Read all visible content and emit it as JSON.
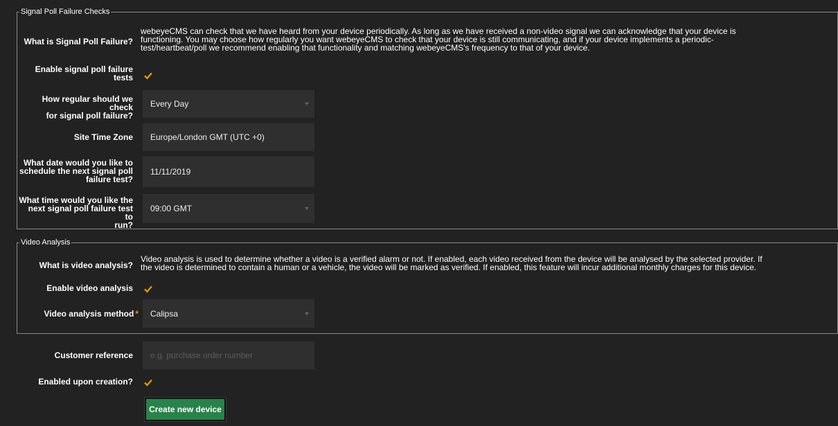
{
  "signal_poll": {
    "legend": "Signal Poll Failure Checks",
    "what_label": "What is Signal Poll Failure?",
    "what_desc_lines": [
      "webeyeCMS can check that we have heard from your device periodically. As long as we have received a non-video signal we can acknowledge that your device is",
      "functioning. You may choose how regularly you want webeyeCMS to check that your device is still communicating, and if your device implements a periodic-",
      "test/heartbeat/poll we recommend enabling that functionality and matching webeyeCMS's frequency to that of your device."
    ],
    "enable_label_lines": [
      "Enable signal poll failure",
      "tests"
    ],
    "enable_checked": true,
    "frequency_label_lines": [
      "How regular should we check",
      "for signal poll failure?"
    ],
    "frequency_value": "Every Day",
    "timezone_label": "Site Time Zone",
    "timezone_value": "Europe/London GMT (UTC +0)",
    "date_label_lines": [
      "What date would you like to",
      "schedule the next signal poll",
      "failure test?"
    ],
    "date_value": "11/11/2019",
    "time_label_lines": [
      "What time would you like the",
      "next signal poll failure test to",
      "run?"
    ],
    "time_value": "09:00 GMT"
  },
  "video_analysis": {
    "legend": "Video Analysis",
    "what_label": "What is video analysis?",
    "what_desc_lines": [
      "Video analysis is used to determine whether a video is a verified alarm or not. If enabled, each video received from the device will be analysed by the selected provider. If",
      "the video is determined to contain a human or a vehicle, the video will be marked as verified. If enabled, this feature will incur additional monthly charges for this device."
    ],
    "enable_label": "Enable video analysis",
    "enable_checked": true,
    "method_label": "Video analysis method",
    "method_required": "*",
    "method_value": "Calipsa"
  },
  "customer_reference": {
    "label": "Customer reference",
    "placeholder": "e.g. purchase order number",
    "value": ""
  },
  "enabled_on_creation": {
    "label": "Enabled upon creation?",
    "checked": true
  },
  "create_button_label": "Create new device",
  "colors": {
    "background": "#222222",
    "input_background": "#2f2f2f",
    "checkmark": "#e69500",
    "button": "#27834a",
    "border": "#8a8a8a"
  }
}
